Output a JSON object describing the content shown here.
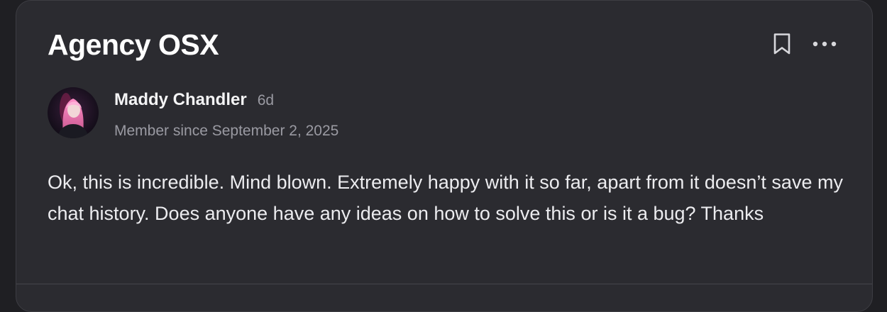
{
  "post": {
    "title": "Agency OSX",
    "author": {
      "name": "Maddy Chandler",
      "posted_ago": "6d",
      "member_since": "Member since September 2, 2025"
    },
    "body": "Ok, this is incredible. Mind blown. Extremely happy with it so far, apart from it doesn’t save my chat history. Does anyone have any ideas on how to solve this or is it a bug? Thanks"
  },
  "actions": {
    "bookmark_icon": "bookmark-icon",
    "more_icon": "more-horizontal-icon"
  },
  "colors": {
    "background": "#1f1f23",
    "card": "#2b2b30",
    "text": "#ececef",
    "muted_text": "#9a9aa2"
  }
}
